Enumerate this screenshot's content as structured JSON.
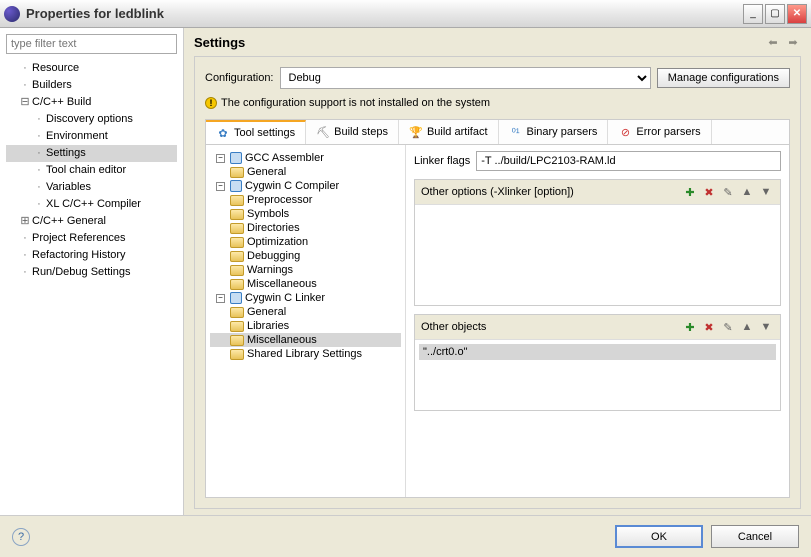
{
  "window": {
    "title": "Properties for ledblink"
  },
  "left": {
    "filter_placeholder": "type filter text",
    "items": {
      "resource": "Resource",
      "builders": "Builders",
      "cpp_build": "C/C++ Build",
      "discovery": "Discovery options",
      "environment": "Environment",
      "settings": "Settings",
      "toolchain": "Tool chain editor",
      "variables": "Variables",
      "xl": "XL C/C++ Compiler",
      "cpp_general": "C/C++ General",
      "proj_refs": "Project References",
      "refactoring": "Refactoring History",
      "rundebug": "Run/Debug Settings"
    }
  },
  "right": {
    "heading": "Settings",
    "config_label": "Configuration:",
    "config_value": "Debug",
    "manage": "Manage configurations",
    "warning": "The configuration support is not installed on the system"
  },
  "tabs": {
    "tool": "Tool settings",
    "build_steps": "Build steps",
    "build_artifact": "Build artifact",
    "binary_parsers": "Binary parsers",
    "error_parsers": "Error parsers"
  },
  "tooltree": {
    "gcc_asm": "GCC Assembler",
    "general1": "General",
    "cygwin_compiler": "Cygwin C Compiler",
    "preprocessor": "Preprocessor",
    "symbols": "Symbols",
    "directories": "Directories",
    "optimization": "Optimization",
    "debugging": "Debugging",
    "warnings": "Warnings",
    "misc1": "Miscellaneous",
    "cygwin_linker": "Cygwin C Linker",
    "general2": "General",
    "libraries": "Libraries",
    "misc2": "Miscellaneous",
    "shared": "Shared Library Settings"
  },
  "detail": {
    "linker_flags_label": "Linker flags",
    "linker_flags_value": "-T ../build/LPC2103-RAM.ld",
    "other_options_label": "Other options (-Xlinker [option])",
    "other_objects_label": "Other objects",
    "other_objects_item0": "\"../crt0.o\""
  },
  "buttons": {
    "ok": "OK",
    "cancel": "Cancel"
  }
}
